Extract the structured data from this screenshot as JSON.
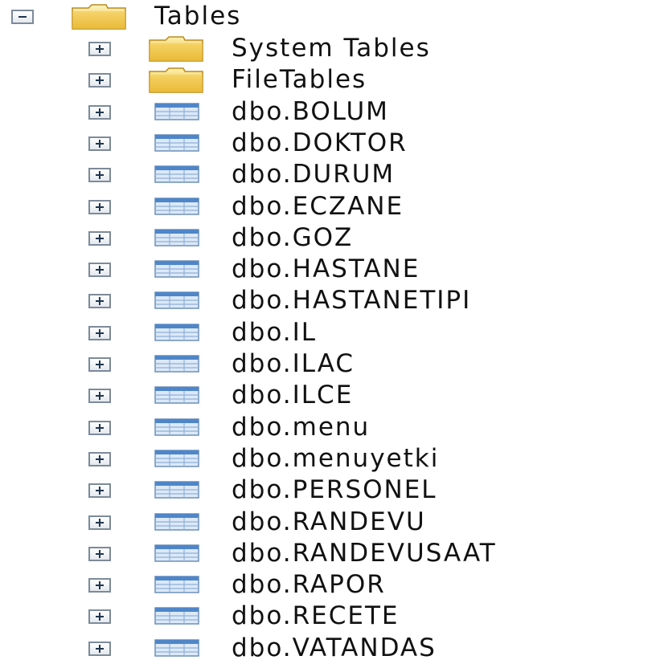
{
  "tree": {
    "root": {
      "label": "Tables",
      "expanded": true,
      "icon": "folder-icon"
    },
    "children": [
      {
        "label": "System Tables",
        "icon": "folder-icon"
      },
      {
        "label": "FileTables",
        "icon": "folder-icon"
      },
      {
        "label": "dbo.BOLUM",
        "icon": "table-icon"
      },
      {
        "label": "dbo.DOKTOR",
        "icon": "table-icon"
      },
      {
        "label": "dbo.DURUM",
        "icon": "table-icon"
      },
      {
        "label": "dbo.ECZANE",
        "icon": "table-icon"
      },
      {
        "label": "dbo.GOZ",
        "icon": "table-icon"
      },
      {
        "label": "dbo.HASTANE",
        "icon": "table-icon"
      },
      {
        "label": "dbo.HASTANETIPI",
        "icon": "table-icon"
      },
      {
        "label": "dbo.IL",
        "icon": "table-icon"
      },
      {
        "label": "dbo.ILAC",
        "icon": "table-icon"
      },
      {
        "label": "dbo.ILCE",
        "icon": "table-icon"
      },
      {
        "label": "dbo.menu",
        "icon": "table-icon"
      },
      {
        "label": "dbo.menuyetki",
        "icon": "table-icon"
      },
      {
        "label": "dbo.PERSONEL",
        "icon": "table-icon"
      },
      {
        "label": "dbo.RANDEVU",
        "icon": "table-icon"
      },
      {
        "label": "dbo.RANDEVUSAAT",
        "icon": "table-icon"
      },
      {
        "label": "dbo.RAPOR",
        "icon": "table-icon"
      },
      {
        "label": "dbo.RECETE",
        "icon": "table-icon"
      },
      {
        "label": "dbo.VATANDAS",
        "icon": "table-icon"
      }
    ]
  },
  "colors": {
    "folder_light": "#fff3b0",
    "folder_dark": "#e0a820",
    "table_header": "#4f86c9",
    "table_body": "#dce9f8",
    "expander_border": "#7d8a99",
    "text": "#111111"
  }
}
